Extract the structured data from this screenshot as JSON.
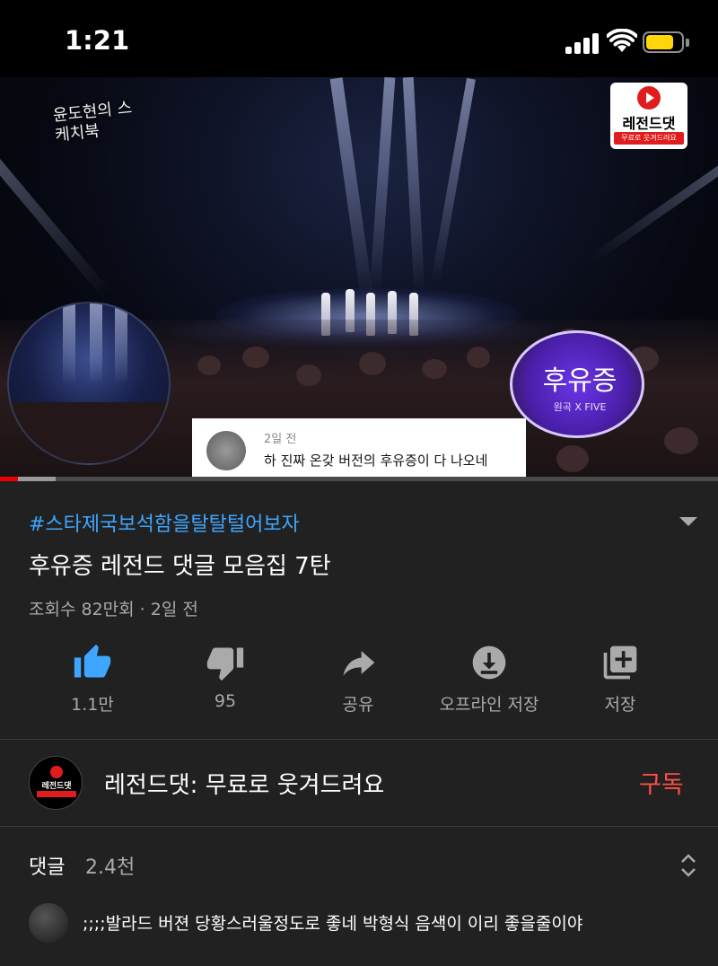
{
  "status_bar": {
    "time": "1:21",
    "icons": [
      "cellular-signal-icon",
      "wifi-icon",
      "battery-icon"
    ],
    "battery_color": "#ffd60a"
  },
  "video": {
    "watermark_show": "윤도현의 스케치북",
    "channel_logo": {
      "name": "레전드댓",
      "tagline": "무료로 웃겨드려요"
    },
    "song_badge": {
      "title": "후유증",
      "artist": "원곡 X FIVE"
    },
    "overlay_comment": {
      "meta": "2일 전",
      "text": "하 진짜 온갖 버전의 후유증이 다 나오네"
    },
    "progress_played": 0.025,
    "progress_buffered": 0.078
  },
  "info": {
    "hashtag": "#스타제국보석함을탈탈털어보자",
    "title": "후유증 레전드 댓글 모음집 7탄",
    "meta": "조회수 82만회 · 2일 전",
    "accent": "#3ea6ff"
  },
  "actions": [
    {
      "icon": "thumbs-up-icon",
      "label": "1.1만",
      "active": true
    },
    {
      "icon": "thumbs-down-icon",
      "label": "95"
    },
    {
      "icon": "share-icon",
      "label": "공유"
    },
    {
      "icon": "download-icon",
      "label": "오프라인 저장"
    },
    {
      "icon": "add-to-playlist-icon",
      "label": "저장"
    }
  ],
  "channel": {
    "avatar_name": "레전드댓",
    "name": "레전드댓: 무료로 웃겨드려요",
    "subscribe_label": "구독",
    "subscribe_color": "#ff4e45"
  },
  "comments": {
    "header": "댓글",
    "count": "2.4천",
    "first": {
      "text": ";;;;발라드 버젼 당황스러울정도로 좋네 박형식 음색이 이리 좋을줄이야"
    }
  }
}
